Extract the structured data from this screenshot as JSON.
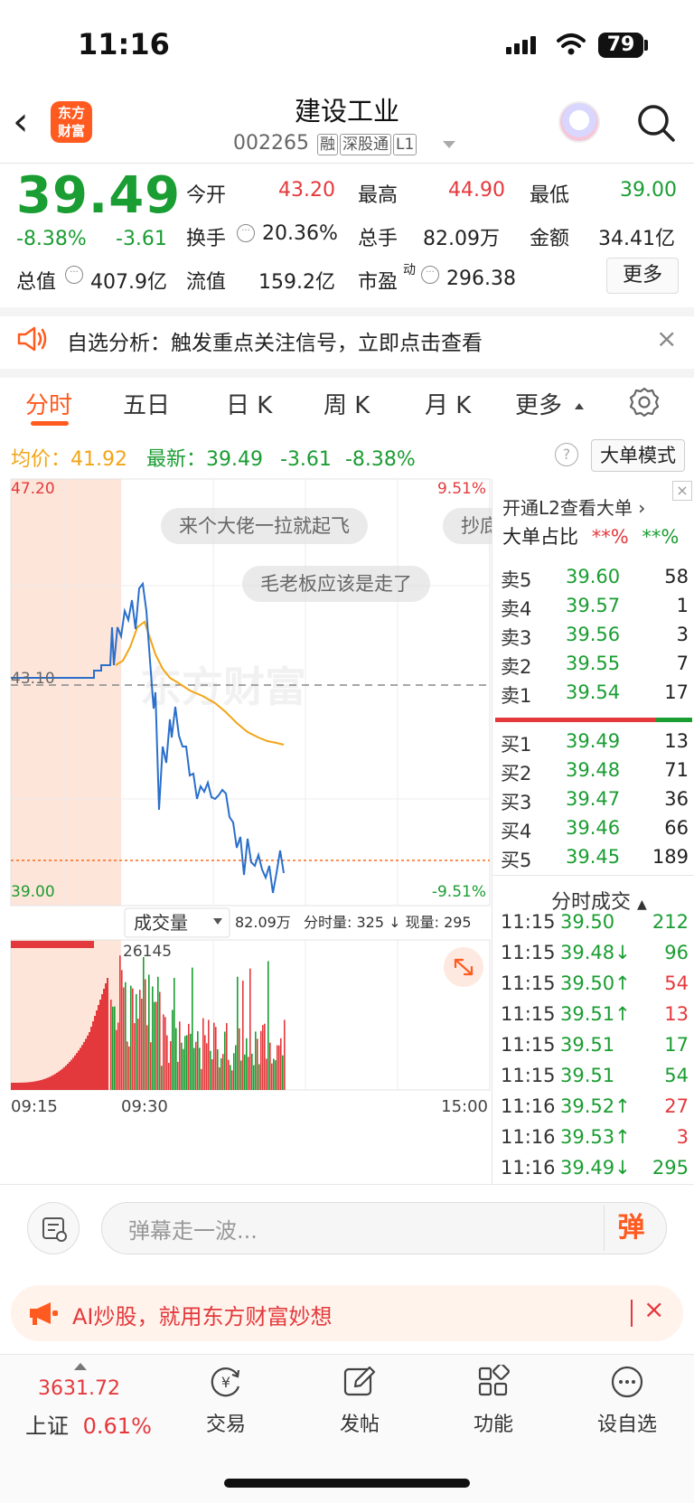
{
  "status": {
    "time": "11:16",
    "battery": "79"
  },
  "header": {
    "stock_name": "建设工业",
    "stock_code": "002265",
    "tags": [
      "融",
      "深股通",
      "L1"
    ],
    "logo_text_1": "东方",
    "logo_text_2": "财富"
  },
  "quote": {
    "price": "39.49",
    "change_pct": "-8.38%",
    "change_amt": "-3.61",
    "open_label": "今开",
    "open": "43.20",
    "high_label": "最高",
    "high": "44.90",
    "low_label": "最低",
    "low": "39.00",
    "turnover_label": "换手",
    "turnover": "20.36%",
    "volume_label": "总手",
    "volume": "82.09万",
    "amount_label": "金额",
    "amount": "34.41亿",
    "mcap_label": "总值",
    "mcap": "407.9亿",
    "float_label": "流值",
    "float_mcap": "159.2亿",
    "pe_label": "市盈",
    "pe_sup": "动",
    "pe": "296.38",
    "more_label": "更多"
  },
  "alert": {
    "text": "自选分析：触发重点关注信号，立即点击查看"
  },
  "tabs": [
    "分时",
    "五日",
    "日 K",
    "周 K",
    "月 K",
    "更多"
  ],
  "chart_info": {
    "avg_label": "均价：",
    "avg": "41.92",
    "latest_label": "最新：",
    "latest": "39.49",
    "latest_chg": "-3.61",
    "latest_pct": "-8.38%",
    "mode_button": "大单模式"
  },
  "chart": {
    "y_top": "47.20",
    "y_bottom": "39.00",
    "y_mid": "43.10",
    "pct_top": "9.51%",
    "pct_bottom": "-9.51%",
    "volume_selector": "成交量",
    "volume_total": "82.09万",
    "volume_detail": "分时量: 325 ↓ 现量: 295",
    "volume_peak_label": "26145",
    "x_start": "09:15",
    "x_mid": "09:30",
    "x_end": "15:00",
    "danmu": [
      "来个大佬一拉就起飞",
      "毛老板应该是走了",
      "抄底"
    ],
    "watermark": "东方财富"
  },
  "chart_data": {
    "type": "line",
    "series": [],
    "ylim": [
      39.0,
      47.2
    ],
    "pct_range": [
      "-9.51%",
      "9.51%"
    ],
    "reference_price": 43.1,
    "x_range": [
      "09:15",
      "15:00"
    ]
  },
  "orderbook": {
    "l2_text": "开通L2查看大单 ›",
    "big_ratio_label": "大单占比",
    "big_ratio_a": "**%",
    "big_ratio_b": "**%",
    "asks": [
      {
        "label": "卖5",
        "price": "39.60",
        "vol": "58"
      },
      {
        "label": "卖4",
        "price": "39.57",
        "vol": "1"
      },
      {
        "label": "卖3",
        "price": "39.56",
        "vol": "3"
      },
      {
        "label": "卖2",
        "price": "39.55",
        "vol": "7"
      },
      {
        "label": "卖1",
        "price": "39.54",
        "vol": "17"
      }
    ],
    "bids": [
      {
        "label": "买1",
        "price": "39.49",
        "vol": "13"
      },
      {
        "label": "买2",
        "price": "39.48",
        "vol": "71"
      },
      {
        "label": "买3",
        "price": "39.47",
        "vol": "36"
      },
      {
        "label": "买4",
        "price": "39.46",
        "vol": "66"
      },
      {
        "label": "买5",
        "price": "39.45",
        "vol": "189"
      }
    ],
    "trades_title": "分时成交",
    "trades": [
      {
        "time": "11:15",
        "price": "39.50",
        "vol": "212",
        "dir": ""
      },
      {
        "time": "11:15",
        "price": "39.48↓",
        "vol": "96",
        "dir": "down"
      },
      {
        "time": "11:15",
        "price": "39.50↑",
        "vol": "54",
        "dir": "up"
      },
      {
        "time": "11:15",
        "price": "39.51↑",
        "vol": "13",
        "dir": "up"
      },
      {
        "time": "11:15",
        "price": "39.51",
        "vol": "17",
        "dir": ""
      },
      {
        "time": "11:15",
        "price": "39.51",
        "vol": "54",
        "dir": ""
      },
      {
        "time": "11:16",
        "price": "39.52↑",
        "vol": "27",
        "dir": "up"
      },
      {
        "time": "11:16",
        "price": "39.53↑",
        "vol": "3",
        "dir": "up"
      },
      {
        "time": "11:16",
        "price": "39.49↓",
        "vol": "295",
        "dir": "down"
      }
    ]
  },
  "danmu_bar": {
    "placeholder": "弹幕走一波...",
    "send_label": "弹"
  },
  "promo": {
    "text": "AI炒股，就用东方财富妙想"
  },
  "bottom_nav": {
    "index_value": "3631.72",
    "index_name": "上证",
    "index_pct": "0.61%",
    "items": [
      "交易",
      "发帖",
      "功能",
      "设自选"
    ]
  },
  "colors": {
    "up": "#e4393c",
    "down": "#1a9d32",
    "avg_line": "#f2a516",
    "price_line": "#2a6fcb",
    "brand": "#ff5a1f"
  }
}
